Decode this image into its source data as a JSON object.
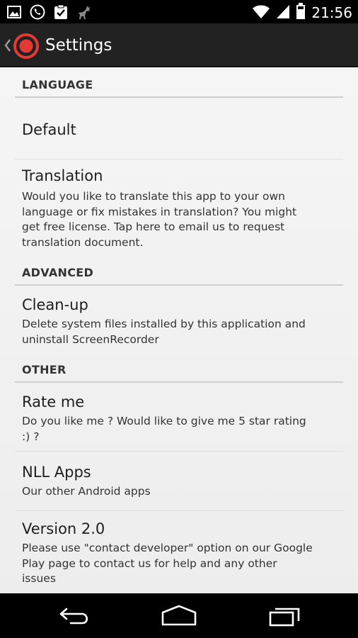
{
  "status_bar": {
    "time": "21:56",
    "icons": [
      "image-icon",
      "phone-icon",
      "clipboard-check-icon",
      "deer-icon",
      "wifi-icon",
      "signal-icon",
      "battery-icon"
    ]
  },
  "action_bar": {
    "title": "Settings",
    "accent_color": "#e53935"
  },
  "sections": {
    "language": {
      "header": "LANGUAGE",
      "default": {
        "title": "Default"
      },
      "translation": {
        "title": "Translation",
        "summary_1": "Would you like to translate this app to your own",
        "summary_2": "language or fix mistakes in translation? You might",
        "summary_3": "get free license. Tap here to email us to request",
        "summary_4": "translation document."
      }
    },
    "advanced": {
      "header": "ADVANCED",
      "cleanup": {
        "title": "Clean-up",
        "summary_1": "Delete system files installed by this application and",
        "summary_2": "uninstall ScreenRecorder"
      }
    },
    "other": {
      "header": "OTHER",
      "rate": {
        "title": "Rate me",
        "summary_1": "Do you like me ? Would like to give me 5 star rating",
        "summary_2": ":) ?"
      },
      "apps": {
        "title": "NLL Apps",
        "summary": "Our other Android apps"
      },
      "version": {
        "title": "Version 2.0",
        "summary_1": "Please use \"contact developer\" option on our Google",
        "summary_2": "Play page to contact us for help and any other",
        "summary_3": "issues"
      }
    }
  },
  "nav_bar": {
    "icons": [
      "back-icon",
      "home-icon",
      "recent-apps-icon"
    ]
  }
}
